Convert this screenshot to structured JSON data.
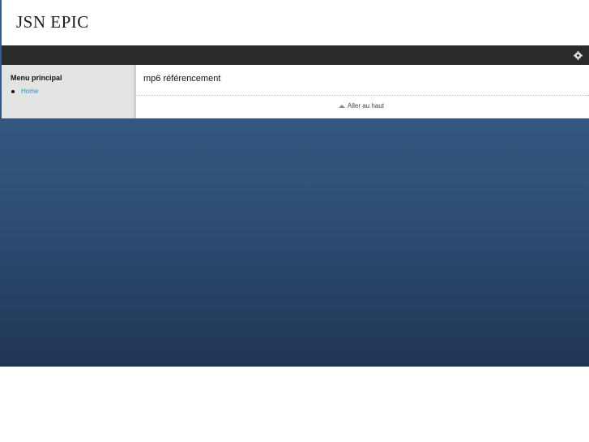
{
  "site": {
    "title": "JSN EPIC"
  },
  "topbar": {
    "gear_icon": "gear-icon"
  },
  "sidebar": {
    "menu_title": "Menu principal",
    "items": [
      {
        "label": "Home"
      }
    ]
  },
  "content": {
    "title": "mp6 référencement",
    "back_to_top": "Aller au haut"
  },
  "colors": {
    "link": "#2a8fc9",
    "topbar": "#2b2b2b",
    "sidebar_bg": "#e3e3e3",
    "page_background": "#34577f"
  }
}
